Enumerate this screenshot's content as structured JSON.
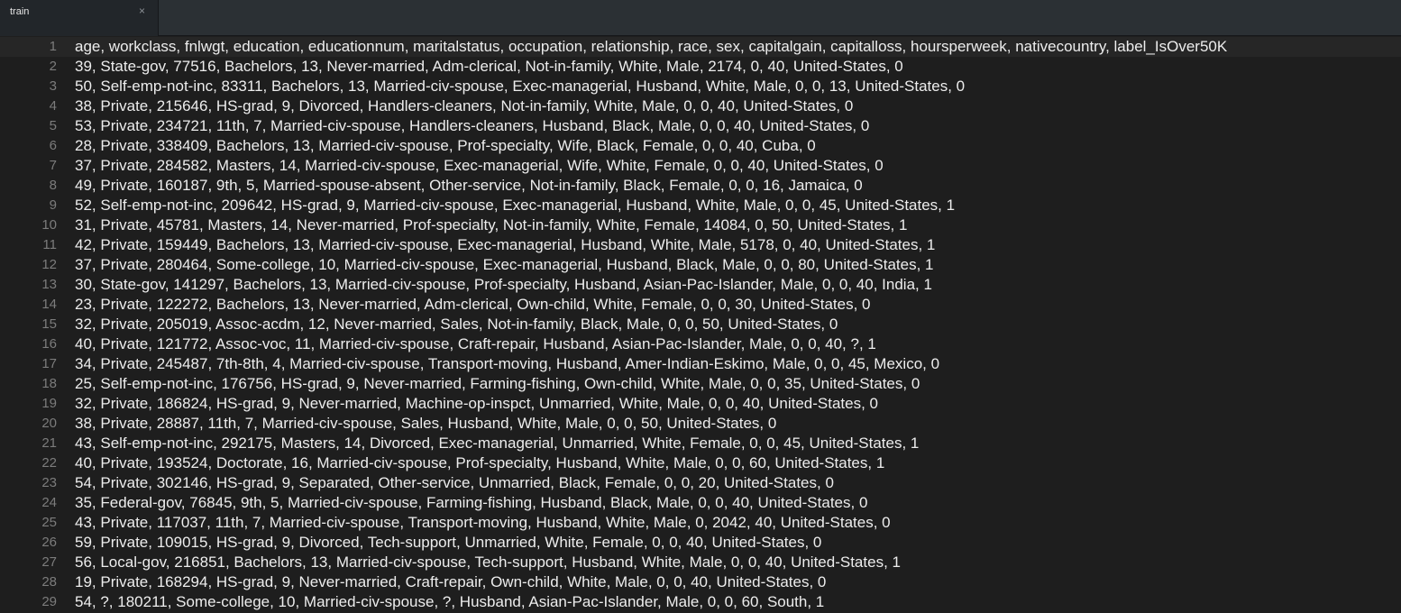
{
  "tab": {
    "title": "train",
    "close": "×"
  },
  "lines": [
    {
      "num": "1",
      "text": "age, workclass, fnlwgt, education, educationnum, maritalstatus, occupation, relationship, race, sex, capitalgain, capitalloss, hoursperweek, nativecountry, label_IsOver50K"
    },
    {
      "num": "2",
      "text": "39, State-gov, 77516, Bachelors, 13, Never-married, Adm-clerical, Not-in-family, White, Male, 2174, 0, 40, United-States, 0"
    },
    {
      "num": "3",
      "text": "50, Self-emp-not-inc, 83311, Bachelors, 13, Married-civ-spouse, Exec-managerial, Husband, White, Male, 0, 0, 13, United-States, 0"
    },
    {
      "num": "4",
      "text": "38, Private, 215646, HS-grad, 9, Divorced, Handlers-cleaners, Not-in-family, White, Male, 0, 0, 40, United-States, 0"
    },
    {
      "num": "5",
      "text": "53, Private, 234721, 11th, 7, Married-civ-spouse, Handlers-cleaners, Husband, Black, Male, 0, 0, 40, United-States, 0"
    },
    {
      "num": "6",
      "text": "28, Private, 338409, Bachelors, 13, Married-civ-spouse, Prof-specialty, Wife, Black, Female, 0, 0, 40, Cuba, 0"
    },
    {
      "num": "7",
      "text": "37, Private, 284582, Masters, 14, Married-civ-spouse, Exec-managerial, Wife, White, Female, 0, 0, 40, United-States, 0"
    },
    {
      "num": "8",
      "text": "49, Private, 160187, 9th, 5, Married-spouse-absent, Other-service, Not-in-family, Black, Female, 0, 0, 16, Jamaica, 0"
    },
    {
      "num": "9",
      "text": "52, Self-emp-not-inc, 209642, HS-grad, 9, Married-civ-spouse, Exec-managerial, Husband, White, Male, 0, 0, 45, United-States, 1"
    },
    {
      "num": "10",
      "text": "31, Private, 45781, Masters, 14, Never-married, Prof-specialty, Not-in-family, White, Female, 14084, 0, 50, United-States, 1"
    },
    {
      "num": "11",
      "text": "42, Private, 159449, Bachelors, 13, Married-civ-spouse, Exec-managerial, Husband, White, Male, 5178, 0, 40, United-States, 1"
    },
    {
      "num": "12",
      "text": "37, Private, 280464, Some-college, 10, Married-civ-spouse, Exec-managerial, Husband, Black, Male, 0, 0, 80, United-States, 1"
    },
    {
      "num": "13",
      "text": "30, State-gov, 141297, Bachelors, 13, Married-civ-spouse, Prof-specialty, Husband, Asian-Pac-Islander, Male, 0, 0, 40, India, 1"
    },
    {
      "num": "14",
      "text": "23, Private, 122272, Bachelors, 13, Never-married, Adm-clerical, Own-child, White, Female, 0, 0, 30, United-States, 0"
    },
    {
      "num": "15",
      "text": "32, Private, 205019, Assoc-acdm, 12, Never-married, Sales, Not-in-family, Black, Male, 0, 0, 50, United-States, 0"
    },
    {
      "num": "16",
      "text": "40, Private, 121772, Assoc-voc, 11, Married-civ-spouse, Craft-repair, Husband, Asian-Pac-Islander, Male, 0, 0, 40, ?, 1"
    },
    {
      "num": "17",
      "text": "34, Private, 245487, 7th-8th, 4, Married-civ-spouse, Transport-moving, Husband, Amer-Indian-Eskimo, Male, 0, 0, 45, Mexico, 0"
    },
    {
      "num": "18",
      "text": "25, Self-emp-not-inc, 176756, HS-grad, 9, Never-married, Farming-fishing, Own-child, White, Male, 0, 0, 35, United-States, 0"
    },
    {
      "num": "19",
      "text": "32, Private, 186824, HS-grad, 9, Never-married, Machine-op-inspct, Unmarried, White, Male, 0, 0, 40, United-States, 0"
    },
    {
      "num": "20",
      "text": "38, Private, 28887, 11th, 7, Married-civ-spouse, Sales, Husband, White, Male, 0, 0, 50, United-States, 0"
    },
    {
      "num": "21",
      "text": "43, Self-emp-not-inc, 292175, Masters, 14, Divorced, Exec-managerial, Unmarried, White, Female, 0, 0, 45, United-States, 1"
    },
    {
      "num": "22",
      "text": "40, Private, 193524, Doctorate, 16, Married-civ-spouse, Prof-specialty, Husband, White, Male, 0, 0, 60, United-States, 1"
    },
    {
      "num": "23",
      "text": "54, Private, 302146, HS-grad, 9, Separated, Other-service, Unmarried, Black, Female, 0, 0, 20, United-States, 0"
    },
    {
      "num": "24",
      "text": "35, Federal-gov, 76845, 9th, 5, Married-civ-spouse, Farming-fishing, Husband, Black, Male, 0, 0, 40, United-States, 0"
    },
    {
      "num": "25",
      "text": "43, Private, 117037, 11th, 7, Married-civ-spouse, Transport-moving, Husband, White, Male, 0, 2042, 40, United-States, 0"
    },
    {
      "num": "26",
      "text": "59, Private, 109015, HS-grad, 9, Divorced, Tech-support, Unmarried, White, Female, 0, 0, 40, United-States, 0"
    },
    {
      "num": "27",
      "text": "56, Local-gov, 216851, Bachelors, 13, Married-civ-spouse, Tech-support, Husband, White, Male, 0, 0, 40, United-States, 1"
    },
    {
      "num": "28",
      "text": "19, Private, 168294, HS-grad, 9, Never-married, Craft-repair, Own-child, White, Male, 0, 0, 40, United-States, 0"
    },
    {
      "num": "29",
      "text": "54, ?, 180211, Some-college, 10, Married-civ-spouse, ?, Husband, Asian-Pac-Islander, Male, 0, 0, 60, South, 1"
    }
  ]
}
